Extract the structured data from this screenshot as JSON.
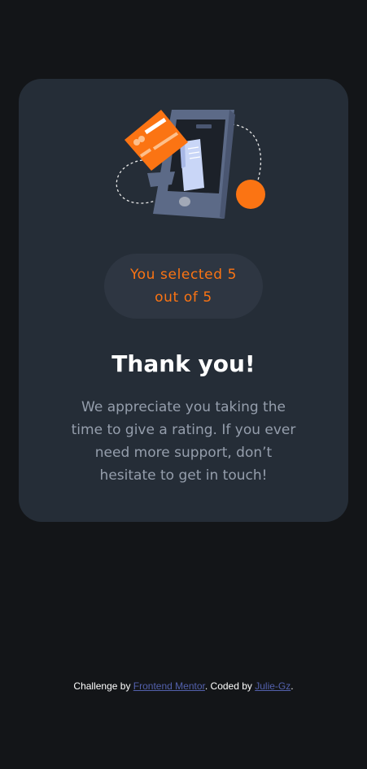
{
  "card": {
    "selection_text": "You selected 5 out of 5",
    "title": "Thank you!",
    "message": "We appreciate you taking the time to give a rating. If you ever need more support, don’t hesitate to get in touch!",
    "illustration_icon": "phone-receipt-card-illustration"
  },
  "footer": {
    "prefix": "Challenge by ",
    "link1_label": "Frontend Mentor",
    "middle": ". Coded by ",
    "link2_label": "Julie-Gz",
    "suffix": "."
  },
  "colors": {
    "background": "#131518",
    "card": "#252d37",
    "pill": "#2e3642",
    "accent": "#fb7413",
    "text_muted": "#959eac",
    "link": "#5361ad"
  }
}
